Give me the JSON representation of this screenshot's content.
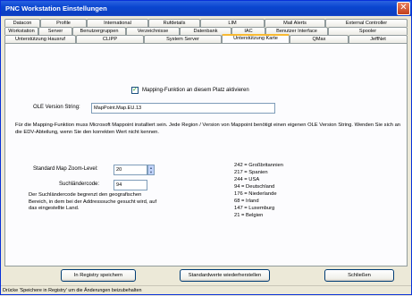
{
  "window": {
    "title": "PNC Workstation Einstellungen",
    "close_glyph": "✕"
  },
  "tabs": {
    "row1": [
      "Datacon",
      "Profile",
      "International",
      "Rufdetails",
      "LIM",
      "Mail Alerts",
      "External Controller"
    ],
    "row2": [
      "Workstation",
      "Server",
      "Benutzergruppen",
      "Verzeichnisse",
      "Datenbank",
      "IAC",
      "Benutzer Interface",
      "Spooler"
    ],
    "row3": [
      "Unterstützung Hausruf",
      "CLIPP",
      "System Server",
      "Unterstützung Karte",
      "QMax",
      "JeffNet"
    ],
    "active": "Unterstützung Karte"
  },
  "mapping": {
    "checkbox_label": "Mapping-Funktion an diesem Platz aktivieren",
    "checked": true,
    "ole_label": "OLE Version String:",
    "ole_value": "MapPoint.Map.EU.13",
    "info_text": "Für die Mapping-Funktion muss Microsoft Mappoint installiert sein. Jede Region / Version von Mappoint benötigt einen eigenen OLE Version String. Wenden Sie sich an die EDV-Abteilung, wenn Sie den korrekten Wert nicht kennen.",
    "zoom_label": "Standard Map Zoom-Level:",
    "zoom_value": "20",
    "country_label": "Suchländercode:",
    "country_value": "94",
    "country_info": "Der Suchländercode begrenzt den geografischen Bereich, in dem bei der Addresssuche gesucht wird, auf das eingestellte Land.",
    "codes": [
      "242 = Großbritannien",
      "217 = Spanien",
      "244 = USA",
      "94   = Deutschland",
      "176 = Niederlande",
      "68   = Irland",
      "147 = Luxemburg",
      "21   = Belgien"
    ]
  },
  "buttons": {
    "save": "In Registry speichern",
    "defaults": "Standardwerte wiederherstellen",
    "close": "Schließen"
  },
  "status": "Drücke 'Speichere in Registry' um die Änderungen beizubehalten"
}
